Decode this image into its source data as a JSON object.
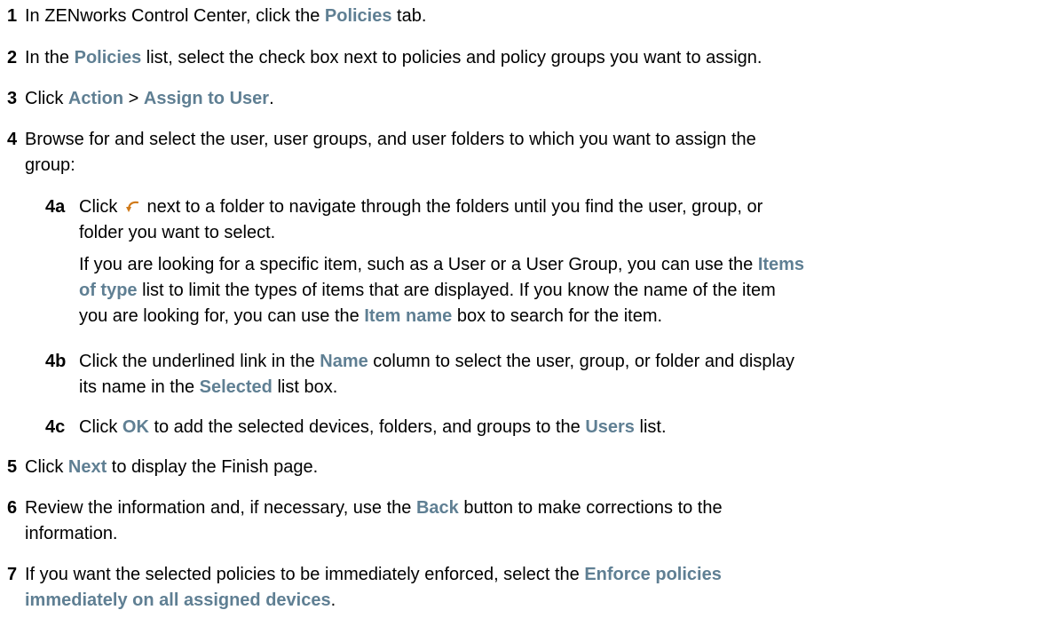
{
  "steps": {
    "s1": {
      "num": "1",
      "a": "In ZENworks Control Center, click the ",
      "b": "Policies",
      "c": " tab."
    },
    "s2": {
      "num": "2",
      "a": "In the ",
      "b": "Policies",
      "c": " list, select the check box next to policies and policy groups you want to assign."
    },
    "s3": {
      "num": "3",
      "a": "Click ",
      "b": "Action",
      "c": " > ",
      "d": "Assign to User",
      "e": "."
    },
    "s4": {
      "num": "4",
      "line1": "Browse for and select the user, user groups, and user folders to which you want to assign the",
      "line2": "group:"
    },
    "s4a": {
      "num": "4a",
      "a": "Click ",
      "icon": "navigate-folder-arrow-icon",
      "b": " next to a folder to navigate through the folders until you find the user, group, or",
      "line2": "folder you want to select.",
      "p1": "If you are looking for a specific item, such as a User or a User Group, you can use the ",
      "p1_ui1": "Items",
      "p2_ui1": "of type",
      "p2": " list to limit the types of items that are displayed. If you know the name of the item",
      "p3": "you are looking for, you can use the ",
      "p3_ui": "Item name",
      "p3_end": " box to search for the item."
    },
    "s4b": {
      "num": "4b",
      "a": "Click the underlined link in the ",
      "b": "Name",
      "c": " column to select the user, group, or folder and display",
      "line2a": "its name in the ",
      "line2b": "Selected",
      "line2c": " list box."
    },
    "s4c": {
      "num": "4c",
      "a": "Click ",
      "b": "OK",
      "c": " to add the selected devices, folders, and groups to the ",
      "d": "Users",
      "e": " list."
    },
    "s5": {
      "num": "5",
      "a": "Click ",
      "b": "Next",
      "c": " to display the Finish page."
    },
    "s6": {
      "num": "6",
      "a": "Review the information and, if necessary, use the ",
      "b": "Back",
      "c": " button to make corrections to the",
      "line2": "information."
    },
    "s7": {
      "num": "7",
      "a": "If you want the selected policies to be immediately enforced, select the ",
      "b": "Enforce policies",
      "line2": "immediately on all assigned devices",
      "end": "."
    }
  },
  "colors": {
    "ui_term": "#5f7f93",
    "icon": "#d07a1a"
  }
}
